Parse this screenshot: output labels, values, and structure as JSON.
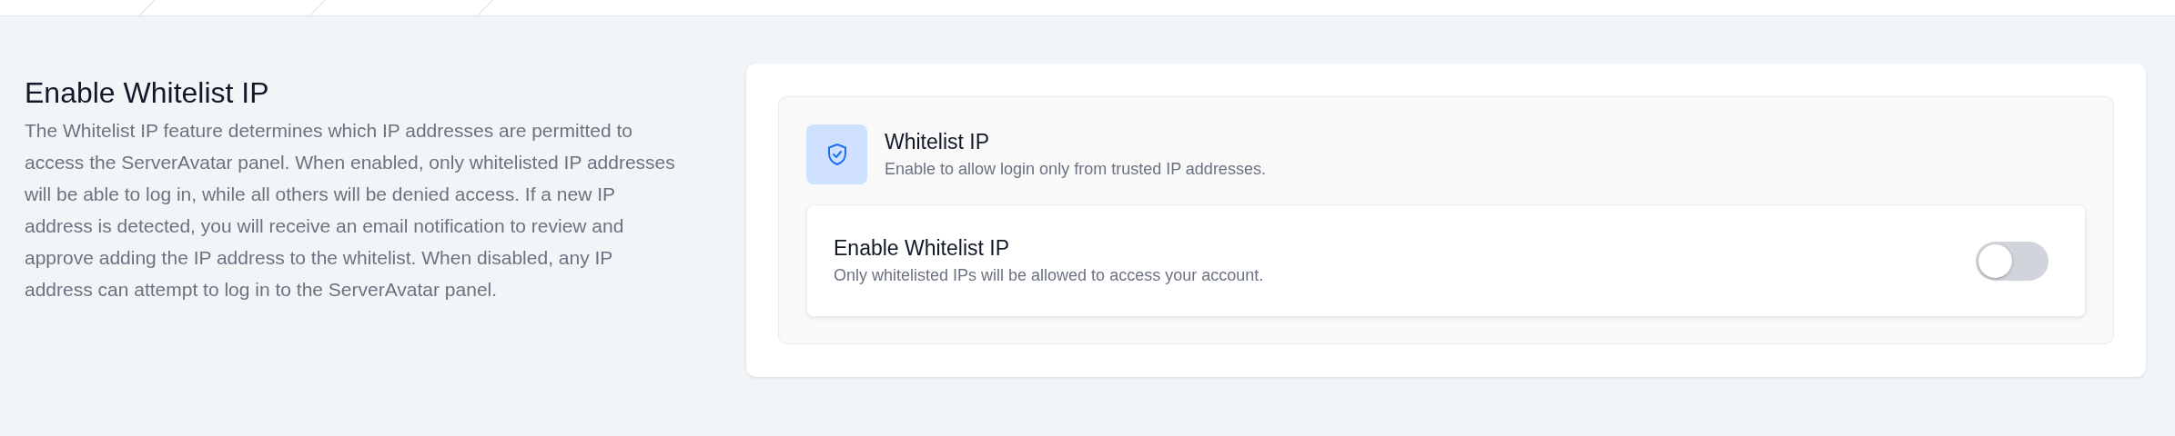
{
  "section": {
    "title": "Enable Whitelist IP",
    "description": "The Whitelist IP feature determines which IP addresses are permitted to access the ServerAvatar panel. When enabled, only whitelisted IP addresses will be able to log in, while all others will be denied access. If a new IP address is detected, you will receive an email notification to review and approve adding the IP address to the whitelist. When disabled, any IP address can attempt to log in to the ServerAvatar panel."
  },
  "panel": {
    "title": "Whitelist IP",
    "subtitle": "Enable to allow login only from trusted IP addresses.",
    "setting": {
      "label": "Enable Whitelist IP",
      "description": "Only whitelisted IPs will be allowed to access your account.",
      "on": false
    }
  }
}
